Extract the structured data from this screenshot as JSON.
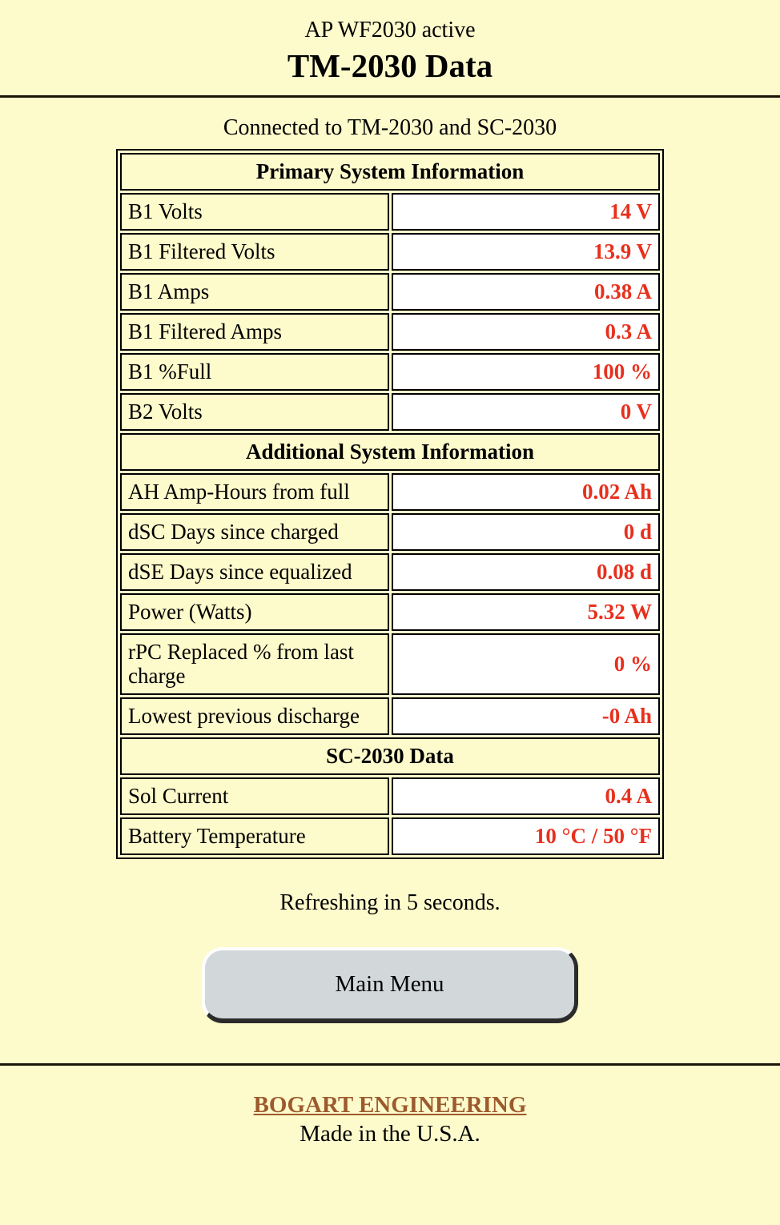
{
  "header": {
    "ap_status": "AP WF2030 active",
    "title": "TM-2030 Data"
  },
  "connection": {
    "status_text": "Connected to TM-2030 and SC-2030"
  },
  "table": {
    "sections": [
      {
        "heading": "Primary System Information",
        "rows": [
          {
            "label": "B1 Volts",
            "value": "14 V"
          },
          {
            "label": "B1 Filtered Volts",
            "value": "13.9 V"
          },
          {
            "label": "B1 Amps",
            "value": "0.38 A"
          },
          {
            "label": "B1 Filtered Amps",
            "value": "0.3 A"
          },
          {
            "label": "B1 %Full",
            "value": "100 %"
          },
          {
            "label": "B2 Volts",
            "value": "0 V"
          }
        ]
      },
      {
        "heading": "Additional System Information",
        "rows": [
          {
            "label": "AH Amp-Hours from full",
            "value": "0.02 Ah"
          },
          {
            "label": "dSC Days since charged",
            "value": "0 d"
          },
          {
            "label": "dSE Days since equalized",
            "value": "0.08 d"
          },
          {
            "label": "Power (Watts)",
            "value": "5.32 W"
          },
          {
            "label": "rPC Replaced % from last charge",
            "value": "0 %"
          },
          {
            "label": "Lowest previous discharge",
            "value": "-0 Ah"
          }
        ]
      },
      {
        "heading": "SC-2030 Data",
        "rows": [
          {
            "label": "Sol Current",
            "value": "0.4 A"
          },
          {
            "label": "Battery Temperature",
            "value": "10 °C / 50 °F"
          }
        ]
      }
    ]
  },
  "refresh": {
    "note": "Refreshing in 5 seconds."
  },
  "actions": {
    "main_menu_label": "Main Menu"
  },
  "footer": {
    "brand": "BOGART ENGINEERING",
    "made_in": "Made in the U.S.A."
  },
  "colors": {
    "page_background": "#FDFACB",
    "value_red": "#E8301D",
    "brand_brown": "#9C5A2D",
    "button_face": "#D2D7DA",
    "rule": "#1A1406"
  }
}
